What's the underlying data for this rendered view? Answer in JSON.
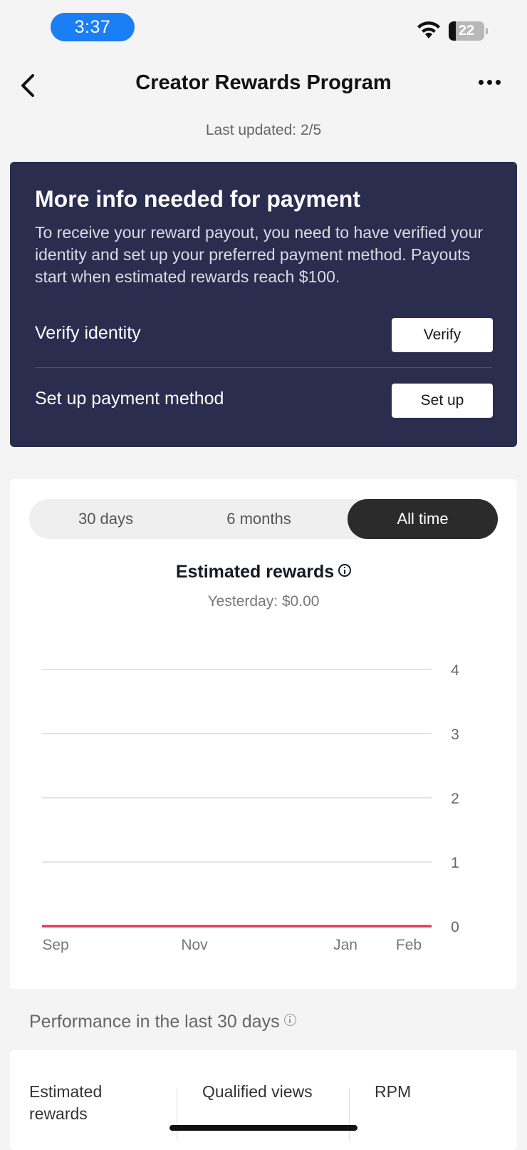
{
  "status_bar": {
    "time": "3:37",
    "battery": "22"
  },
  "nav": {
    "title": "Creator Rewards Program"
  },
  "last_updated": "Last updated: 2/5",
  "payment_card": {
    "title": "More info needed for payment",
    "description": "To receive your reward payout, you need to have verified your identity and set up your preferred payment method. Payouts start when estimated rewards reach $100.",
    "verify_label": "Verify identity",
    "verify_button": "Verify",
    "payment_label": "Set up payment method",
    "payment_button": "Set up"
  },
  "period_tabs": [
    {
      "label": "30 days",
      "active": false
    },
    {
      "label": "6 months",
      "active": false
    },
    {
      "label": "All time",
      "active": true
    }
  ],
  "rewards": {
    "title": "Estimated rewards",
    "yesterday": "Yesterday: $0.00"
  },
  "chart_data": {
    "type": "line",
    "x": [
      "Sep",
      "Nov",
      "Jan",
      "Feb"
    ],
    "series": [
      {
        "values": [
          0,
          0,
          0,
          0
        ],
        "color": "#e5395a"
      }
    ],
    "y_ticks": [
      "0",
      "1",
      "2",
      "3",
      "4"
    ],
    "ylim": [
      0,
      4
    ],
    "grid": true,
    "y_axis_side": "right"
  },
  "performance": {
    "title": "Performance in the last 30 days",
    "columns": [
      "Estimated rewards",
      "Qualified views",
      "RPM"
    ]
  }
}
